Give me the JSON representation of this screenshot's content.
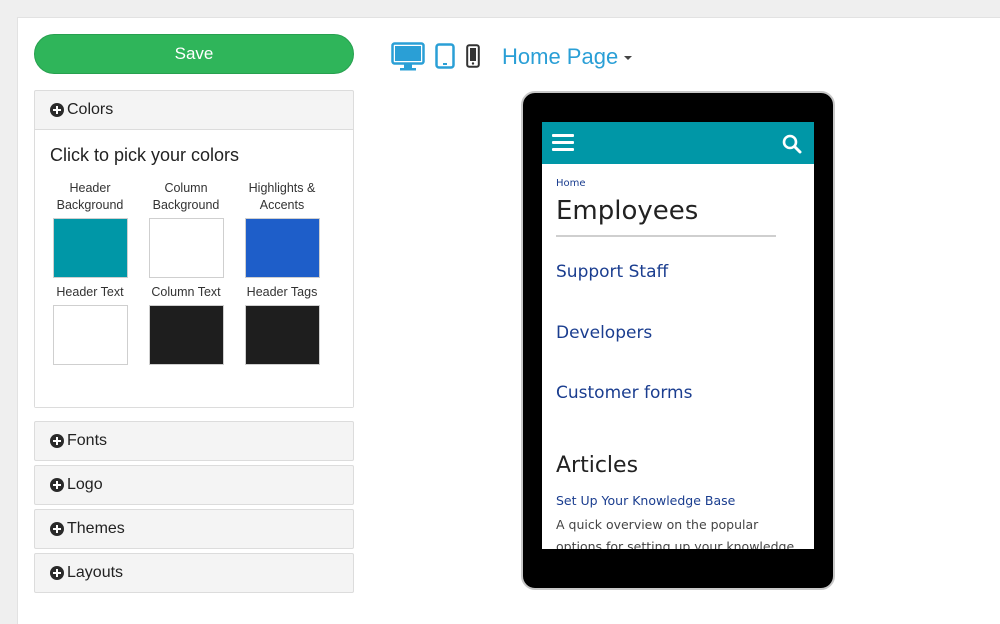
{
  "sidebar": {
    "save_label": "Save",
    "colors": {
      "heading": "Colors",
      "title": "Click to pick your colors",
      "swatches": [
        {
          "label": "Header Background",
          "color": "#0097a7"
        },
        {
          "label": "Column Background",
          "color": "#ffffff"
        },
        {
          "label": "Highlights & Accents",
          "color": "#1e5ec9"
        },
        {
          "label": "Header Text",
          "color": "#ffffff"
        },
        {
          "label": "Column Text",
          "color": "#1e1e1e"
        },
        {
          "label": "Header Tags",
          "color": "#1e1e1e"
        }
      ]
    },
    "sections": [
      "Fonts",
      "Logo",
      "Themes",
      "Layouts"
    ]
  },
  "toolbar": {
    "devices": [
      "desktop-icon",
      "tablet-icon",
      "mobile-icon"
    ],
    "page_select": "Home Page"
  },
  "preview": {
    "breadcrumb": "Home",
    "title": "Employees",
    "links": [
      "Support Staff",
      "Developers",
      "Customer forms"
    ],
    "articles_heading": "Articles",
    "article_title": "Set Up Your Knowledge Base",
    "article_text": "A quick overview on the popular options for setting up your knowledge base"
  },
  "colors": {
    "accent": "#2a9fd6",
    "save_green": "#2fb55a",
    "header_teal": "#0097a7",
    "link_blue": "#1a3d8f"
  }
}
